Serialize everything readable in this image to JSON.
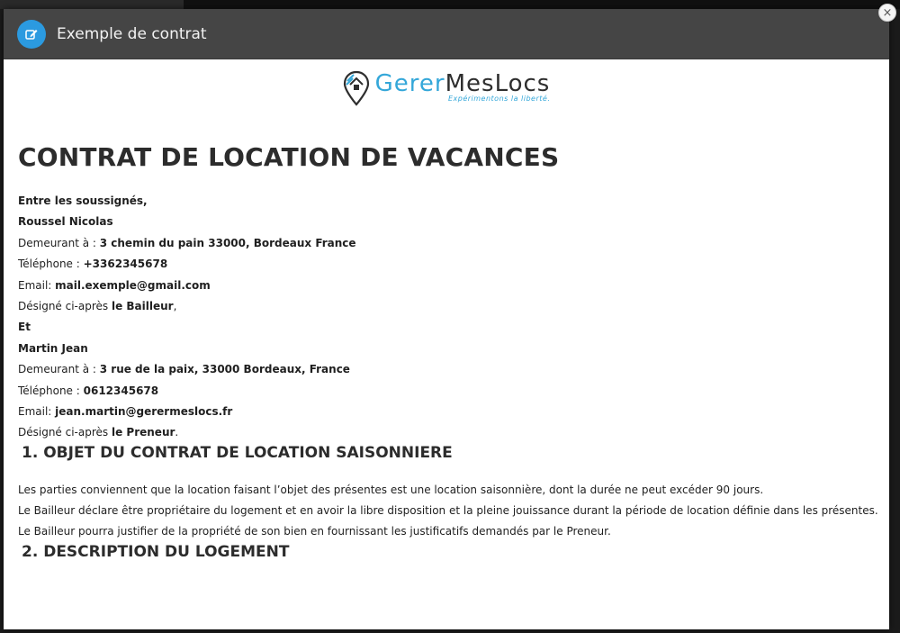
{
  "modal": {
    "title": "Exemple de contrat",
    "close_label": "×"
  },
  "logo": {
    "part1": "Gerer",
    "part2": "MesLocs",
    "tagline": "Expérimentons la liberté."
  },
  "document": {
    "title": "CONTRAT DE LOCATION DE VACANCES",
    "parties": {
      "intro": "Entre les soussignés,",
      "bailleur_name": "Roussel Nicolas",
      "bailleur_address_label": "Demeurant à : ",
      "bailleur_address": "3 chemin du pain 33000, Bordeaux France",
      "bailleur_phone_label": "Téléphone : ",
      "bailleur_phone": "+3362345678",
      "bailleur_email_label": "Email: ",
      "bailleur_email": "mail.exemple@gmail.com",
      "bailleur_designation_prefix": "Désigné ci-après ",
      "bailleur_designation": "le Bailleur",
      "bailleur_designation_suffix": ",",
      "et": "Et",
      "preneur_name": "Martin Jean",
      "preneur_address_label": "Demeurant à : ",
      "preneur_address": "3 rue de la paix, 33000 Bordeaux, France",
      "preneur_phone_label": "Téléphone : ",
      "preneur_phone": "0612345678",
      "preneur_email_label": "Email: ",
      "preneur_email": "jean.martin@gerermeslocs.fr",
      "preneur_designation_prefix": "Désigné ci-après ",
      "preneur_designation": "le Preneur",
      "preneur_designation_suffix": "."
    },
    "section1": {
      "heading": "1. OBJET DU CONTRAT DE LOCATION SAISONNIERE",
      "lines": [
        "Les parties conviennent que la location faisant l’objet des présentes est une location saisonnière, dont la durée ne peut excéder 90 jours.",
        "Le Bailleur déclare être propriétaire du logement et en avoir la libre disposition et la pleine jouissance durant la période de location définie dans les présentes.",
        "Le Bailleur pourra justifier de la propriété de son bien en fournissant les justificatifs demandés par le Preneur."
      ]
    },
    "section2": {
      "heading": "2. DESCRIPTION DU LOGEMENT"
    }
  },
  "colors": {
    "header_bg": "#454545",
    "accent": "#2b9ae0",
    "logo_blue": "#34a7d9"
  }
}
